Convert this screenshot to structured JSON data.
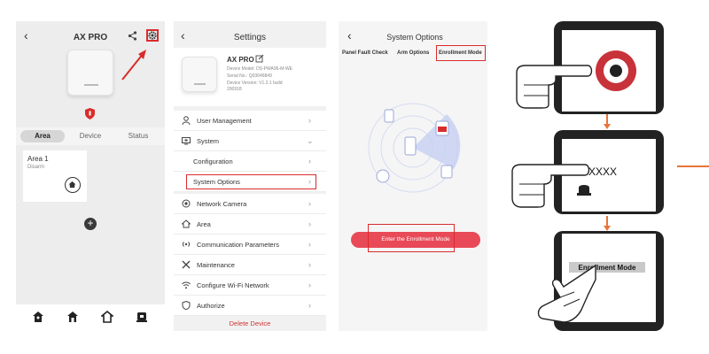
{
  "panel1": {
    "title": "AX PRO",
    "tabs": [
      "Area",
      "Device",
      "Status"
    ],
    "area": {
      "name": "Area 1",
      "status": "Disarm"
    }
  },
  "panel2": {
    "title": "Settings",
    "device": {
      "name": "AX PRO",
      "model": "Device Model: DS-PWA96-M-WE",
      "serial": "Serial No.: Q03046849",
      "version": "Device Version: V1.2.1 build",
      "build": "200918"
    },
    "menu": [
      {
        "label": "User Management",
        "icon": "person-icon"
      },
      {
        "label": "System",
        "icon": "monitor-icon"
      },
      {
        "label": "Configuration",
        "icon": ""
      },
      {
        "label": "System Options",
        "icon": ""
      },
      {
        "label": "Network Camera",
        "icon": "camera-icon"
      },
      {
        "label": "Area",
        "icon": "home-icon"
      },
      {
        "label": "Communication Parameters",
        "icon": "signal-icon"
      },
      {
        "label": "Maintenance",
        "icon": "tools-icon"
      },
      {
        "label": "Configure Wi-Fi Network",
        "icon": "wifi-icon"
      },
      {
        "label": "Authorize",
        "icon": "shield-icon"
      }
    ],
    "delete_label": "Delete Device"
  },
  "panel3": {
    "title": "System Options",
    "segments": [
      "Panel Fault Check",
      "Arm Options",
      "Enrollment Mode"
    ],
    "button_label": "Enter the Enrollment Mode"
  },
  "panel4": {
    "code_text": "XXXX",
    "mode_label": "Enrollment Mode"
  },
  "colors": {
    "highlight_red": "#d92c2c",
    "accent_pink": "#e84a57",
    "arrow_orange": "#e8743b",
    "radar_blue": "#b8c4f0"
  }
}
